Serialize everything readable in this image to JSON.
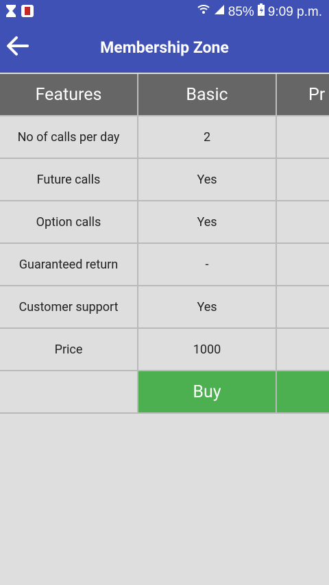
{
  "status_bar": {
    "battery": "85%",
    "time": "9:09 p.m.",
    "icons": [
      "hourglass-icon",
      "app-notification-icon",
      "wifi-icon",
      "signal-icon",
      "battery-charging-icon"
    ]
  },
  "app_bar": {
    "title": "Membership Zone",
    "back_icon": "arrow-left-icon"
  },
  "table": {
    "headers": [
      "Features",
      "Basic",
      "Pr"
    ],
    "rows": [
      {
        "feature": "No of calls per day",
        "basic": "2",
        "premium": ""
      },
      {
        "feature": "Future calls",
        "basic": "Yes",
        "premium": ""
      },
      {
        "feature": "Option calls",
        "basic": "Yes",
        "premium": ""
      },
      {
        "feature": "Guaranteed return",
        "basic": "-",
        "premium": ""
      },
      {
        "feature": "Customer support",
        "basic": "Yes",
        "premium": ""
      },
      {
        "feature": "Price",
        "basic": "1000",
        "premium": ""
      }
    ],
    "buy_label": "Buy"
  },
  "colors": {
    "primary": "#3f51b5",
    "header_bg": "#666666",
    "buy_bg": "#4caf50",
    "background": "#dedede"
  }
}
